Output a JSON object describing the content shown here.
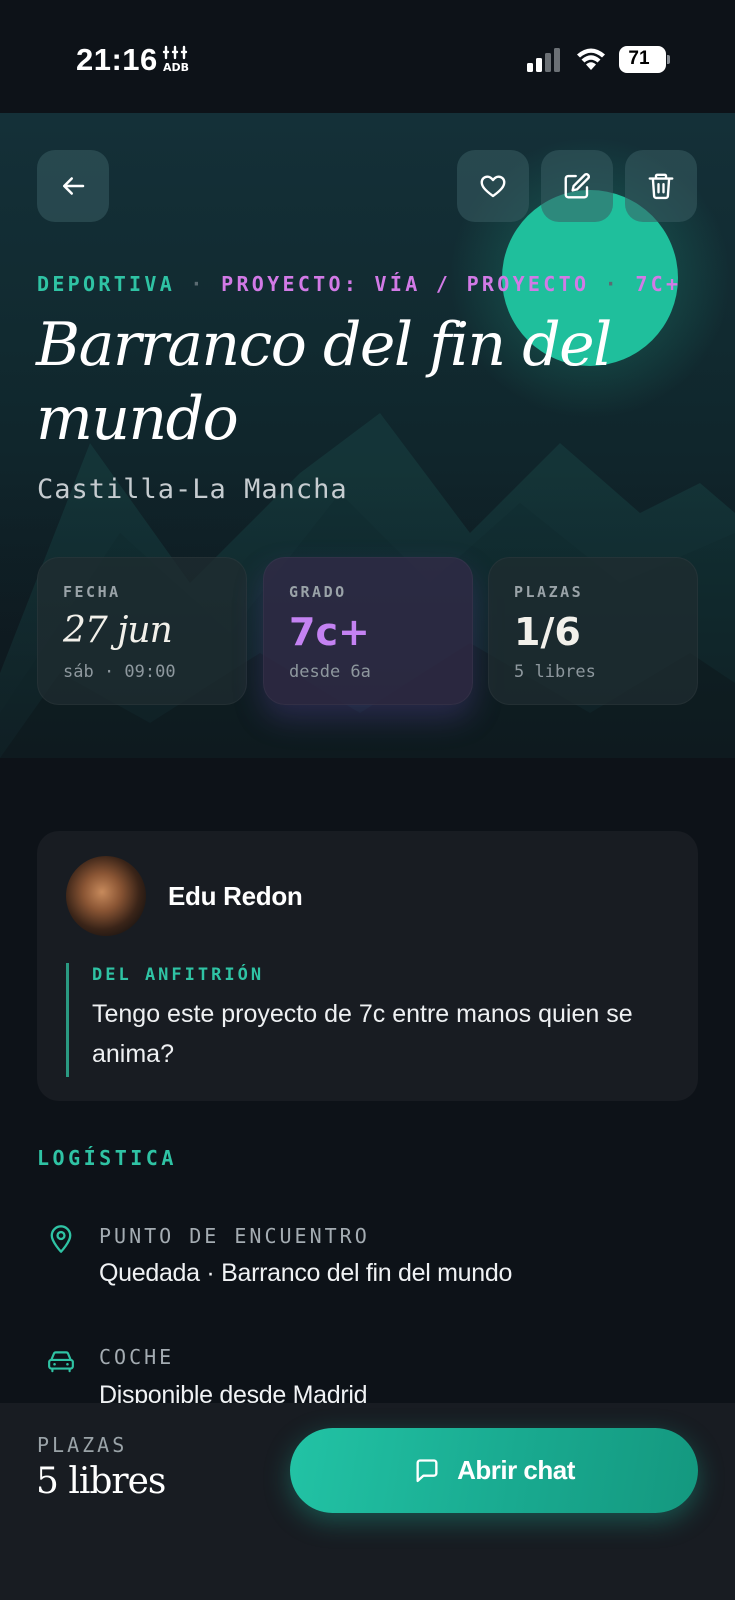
{
  "status_bar": {
    "time": "21:16",
    "time_icon": "ꞈꞈꞈ",
    "battery": "71"
  },
  "hero": {
    "tags": {
      "style": "DEPORTIVA",
      "separator": "·",
      "project": "PROYECTO: VÍA / PROYECTO",
      "grade": "7C+"
    },
    "title": "Barranco del fin del mundo",
    "region": "Castilla-La Mancha"
  },
  "stats": [
    {
      "label": "FECHA",
      "value": "27 jun",
      "sub": "sáb · 09:00"
    },
    {
      "label": "GRADO",
      "value": "7c+",
      "sub": "desde 6a"
    },
    {
      "label": "PLAZAS",
      "value": "1/6",
      "sub": "5 libres"
    }
  ],
  "host": {
    "name": "Edu Redon",
    "quote_label": "DEL ANFITRIÓN",
    "quote": "Tengo este proyecto de 7c entre manos quien se anima?"
  },
  "logistics": {
    "title": "LOGÍSTICA",
    "items": [
      {
        "icon": "map-pin-icon",
        "label": "PUNTO DE ENCUENTRO",
        "value": "Quedada · Barranco del fin del mundo"
      },
      {
        "icon": "car-icon",
        "label": "COCHE",
        "value": "Disponible desde Madrid"
      }
    ]
  },
  "footer": {
    "label": "PLAZAS",
    "value": "5 libres",
    "chat_button": "Abrir chat"
  },
  "colors": {
    "accent_green": "#2fc3a4",
    "accent_purple": "#c482f2",
    "background": "#0d1218",
    "card": "#181c22"
  }
}
